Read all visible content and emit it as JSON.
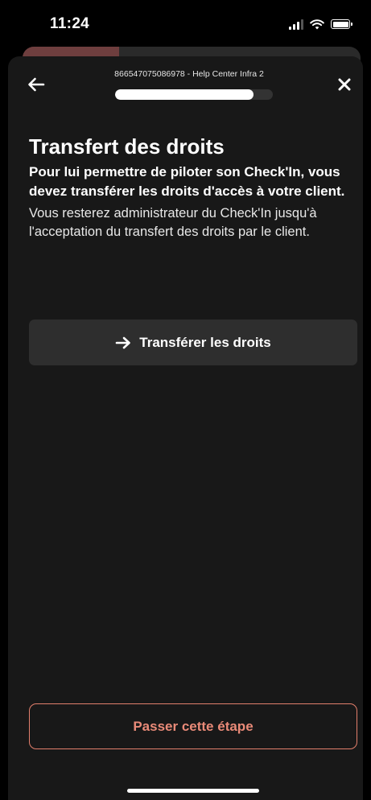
{
  "status_bar": {
    "time": "11:24",
    "icons": [
      "signal-icon",
      "wifi-icon",
      "battery-icon"
    ]
  },
  "header": {
    "title": "866547075086978 - Help Center Infra 2",
    "progress_fraction": 0.88,
    "back_icon": "arrow-left-icon",
    "close_icon": "close-icon"
  },
  "content": {
    "title": "Transfert des droits",
    "lead": "Pour lui permettre de piloter son Check'In, vous devez transférer les droits d'accès à votre client.",
    "body": "Vous resterez administrateur du Check'In jusqu'à l'acceptation du transfert des droits par le client."
  },
  "actions": {
    "transfer_label": "Transférer les droits",
    "transfer_icon": "arrow-right-icon",
    "skip_label": "Passer cette étape"
  },
  "colors": {
    "background": "#000000",
    "sheet": "#181818",
    "button_dark": "#2e2e2e",
    "accent": "#e98a78"
  }
}
